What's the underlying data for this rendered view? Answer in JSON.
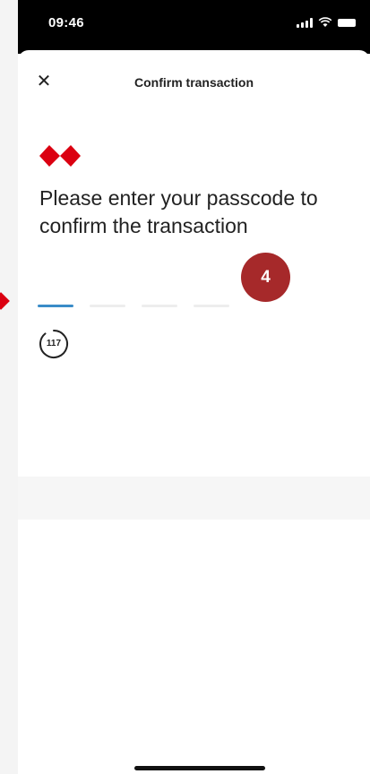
{
  "status_bar": {
    "time": "09:46",
    "icons": [
      "signal-icon",
      "wifi-icon",
      "battery-icon"
    ]
  },
  "header": {
    "close_icon": "close-icon",
    "close_symbol": "✕",
    "title": "Confirm transaction"
  },
  "brand": {
    "logo": "hsbc-hexagon-logo",
    "accent_color": "#db0011"
  },
  "main": {
    "heading": "Please enter your passcode to confirm the  transaction",
    "passcode": {
      "digits_total": 4,
      "digits_entered": 0
    },
    "timer_seconds": "117"
  },
  "annotation": {
    "step_number": "4",
    "badge_color": "#a6292a"
  },
  "colors": {
    "active_slot": "#3a8cc8",
    "inactive_slot": "#ededed"
  }
}
